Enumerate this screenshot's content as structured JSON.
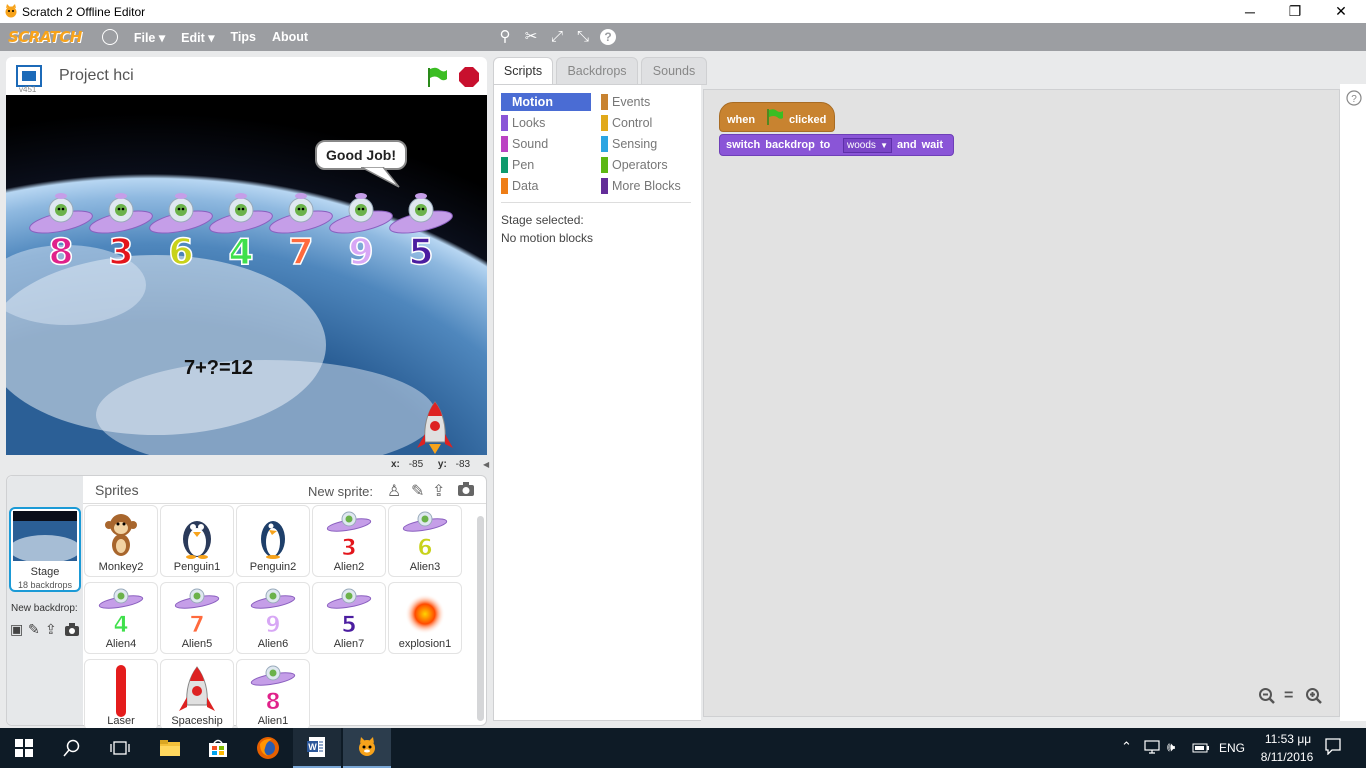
{
  "window": {
    "title": "Scratch 2 Offline Editor",
    "minimize": "─",
    "restore": "❐",
    "close": "✕"
  },
  "menu": {
    "logo": "SCRATCH",
    "file": "File ▾",
    "edit": "Edit ▾",
    "tips": "Tips",
    "about": "About"
  },
  "stage_header": {
    "project_title": "Project hci",
    "version": "v451"
  },
  "stage": {
    "speech": "Good Job!",
    "equation": "7+?=12",
    "alien_numbers": [
      "8",
      "3",
      "6",
      "4",
      "7",
      "9",
      "5"
    ],
    "alien_colors": [
      "#e0218a",
      "#e3151b",
      "#c8d21b",
      "#3fe04b",
      "#ff6a3d",
      "#d7a7f5",
      "#4b1da0"
    ]
  },
  "coords": {
    "x_label": "x:",
    "x_value": "-85",
    "y_label": "y:",
    "y_value": "-83"
  },
  "sprites_panel": {
    "title": "Sprites",
    "new_sprite_label": "New sprite:",
    "stage_label": "Stage",
    "stage_sub": "18 backdrops",
    "new_backdrop_label": "New backdrop:",
    "sprites": [
      {
        "name": "Monkey2",
        "kind": "monkey"
      },
      {
        "name": "Penguin1",
        "kind": "penguin"
      },
      {
        "name": "Penguin2",
        "kind": "penguin2"
      },
      {
        "name": "Alien2",
        "kind": "alien",
        "num": "3",
        "color": "#e3151b"
      },
      {
        "name": "Alien3",
        "kind": "alien",
        "num": "6",
        "color": "#c8d21b"
      },
      {
        "name": "Alien4",
        "kind": "alien",
        "num": "4",
        "color": "#3fe04b"
      },
      {
        "name": "Alien5",
        "kind": "alien",
        "num": "7",
        "color": "#ff6a3d"
      },
      {
        "name": "Alien6",
        "kind": "alien",
        "num": "9",
        "color": "#d7a7f5"
      },
      {
        "name": "Alien7",
        "kind": "alien",
        "num": "5",
        "color": "#4b1da0"
      },
      {
        "name": "explosion1",
        "kind": "explosion"
      },
      {
        "name": "Laser",
        "kind": "laser"
      },
      {
        "name": "Spaceship",
        "kind": "ship"
      },
      {
        "name": "Alien1",
        "kind": "alien",
        "num": "8",
        "color": "#e0218a"
      }
    ]
  },
  "tabs": {
    "scripts": "Scripts",
    "backdrops": "Backdrops",
    "sounds": "Sounds"
  },
  "palette": {
    "categories": [
      {
        "label": "Motion",
        "color": "#4a6cd4",
        "selected": true
      },
      {
        "label": "Looks",
        "color": "#8a55d7"
      },
      {
        "label": "Sound",
        "color": "#bb42c3"
      },
      {
        "label": "Pen",
        "color": "#0e9a6c"
      },
      {
        "label": "Data",
        "color": "#ee7d16"
      },
      {
        "label": "Events",
        "color": "#c88330"
      },
      {
        "label": "Control",
        "color": "#e1a91a"
      },
      {
        "label": "Sensing",
        "color": "#2ca5e2"
      },
      {
        "label": "Operators",
        "color": "#5cb712"
      },
      {
        "label": "More Blocks",
        "color": "#632d99"
      }
    ],
    "stage_selected": "Stage selected:",
    "no_blocks": "No motion blocks"
  },
  "script": {
    "hat_when": "when",
    "hat_clicked": "clicked",
    "block_text1": "switch backdrop to",
    "block_dropdown": "woods",
    "block_text2": "and wait"
  },
  "taskbar": {
    "lang": "ENG",
    "time": "11:53 μμ",
    "date": "8/11/2016"
  }
}
